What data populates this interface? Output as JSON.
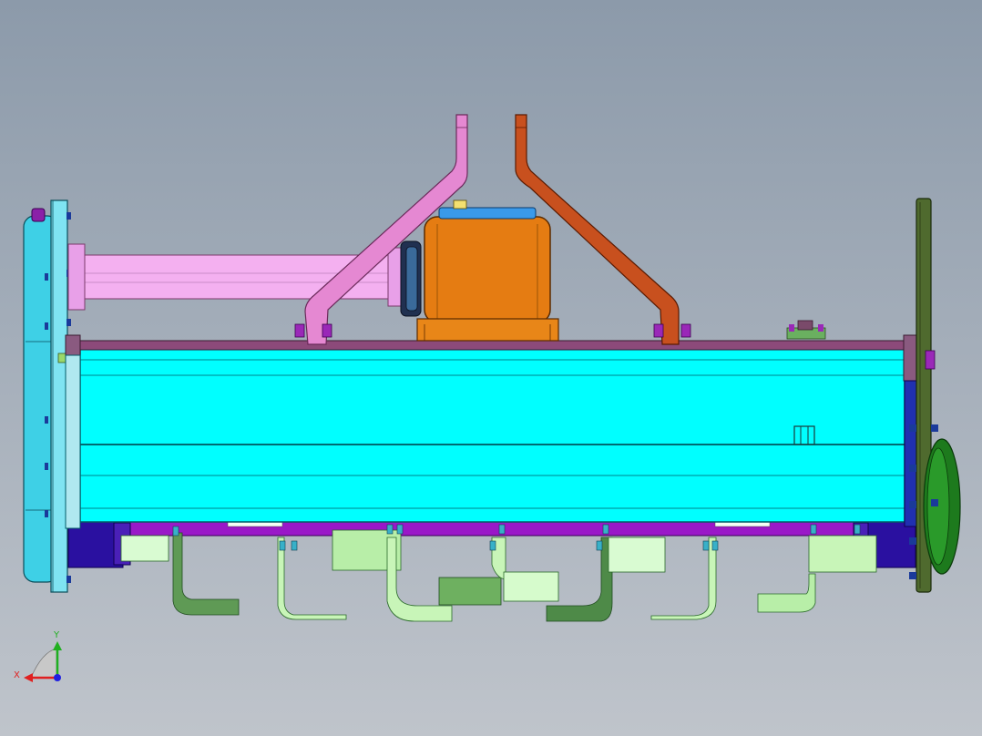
{
  "viewport": {
    "background_top": "#8c9aaa",
    "background_bottom": "#bfc4cb"
  },
  "triad": {
    "x_label": "X",
    "y_label": "Y",
    "x_color": "#e02020",
    "y_color": "#20b020",
    "z_color": "#2020e0"
  },
  "colors": {
    "housing": "#00ffff",
    "housing_edge": "#006a78",
    "gearbox": "#e07b10",
    "driveshaft": "#f0a8f0",
    "left_arm": "#e884d0",
    "right_arm": "#c85020",
    "left_plate": "#40d0e8",
    "right_plate": "#4a6a2a",
    "rotor_shaft": "#8a10b0",
    "blade_light": "#c8f5b8",
    "blade_dark": "#5a9050",
    "bolt": "#38b0c8"
  }
}
